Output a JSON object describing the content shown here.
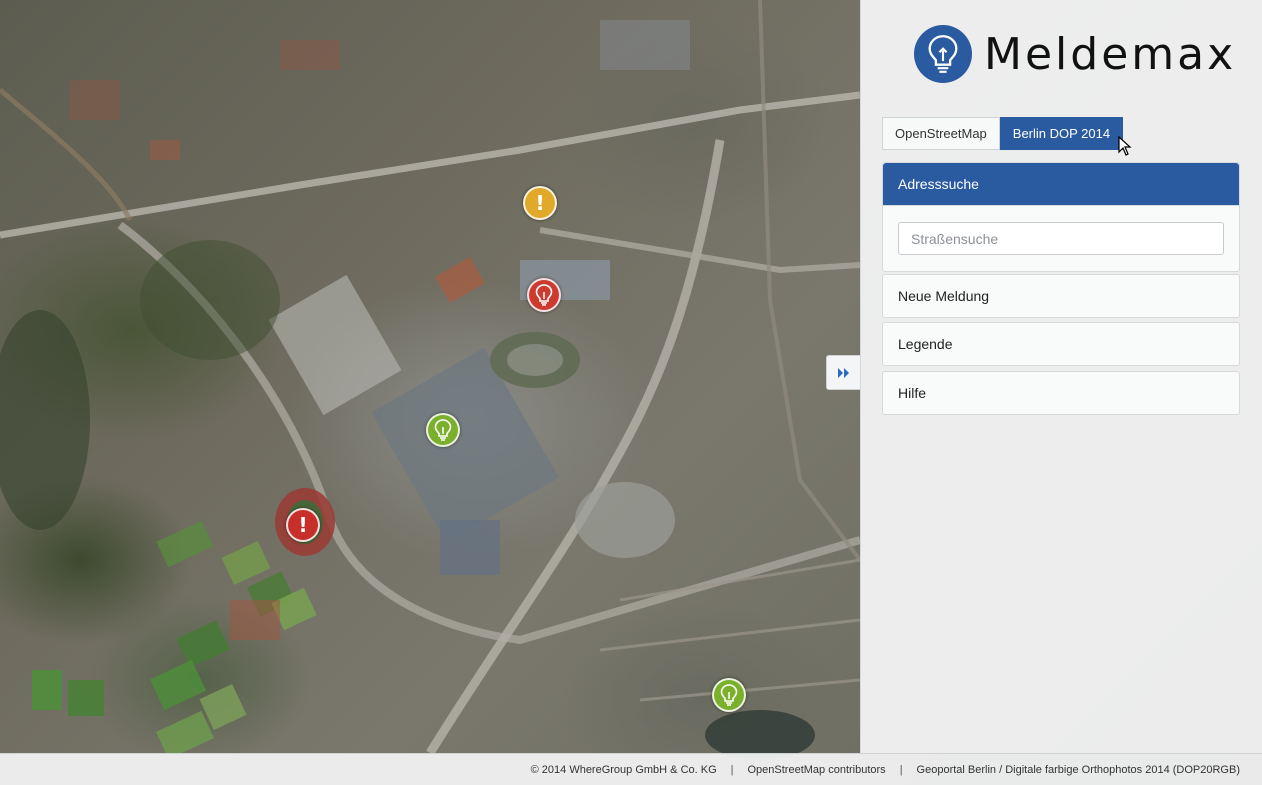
{
  "app": {
    "title": "Meldemax"
  },
  "layers": [
    {
      "label": "OpenStreetMap",
      "active": false
    },
    {
      "label": "Berlin DOP 2014",
      "active": true
    }
  ],
  "panels": {
    "address_search": {
      "title": "Adresssuche",
      "placeholder": "Straßensuche",
      "value": ""
    },
    "new_report": {
      "title": "Neue Meldung"
    },
    "legend": {
      "title": "Legende"
    },
    "help": {
      "title": "Hilfe"
    }
  },
  "collapse_button": {
    "icon": "double-chevron-right-icon",
    "glyph": "⏩"
  },
  "markers": [
    {
      "type": "warning",
      "color": "#e0a92a",
      "glyph": "!"
    },
    {
      "type": "report-red",
      "color": "#cc3b30",
      "glyph": "bulb"
    },
    {
      "type": "report-green",
      "color": "#7bb02c",
      "glyph": "bulb"
    },
    {
      "type": "warning-red",
      "color": "#c7302a",
      "glyph": "!"
    },
    {
      "type": "report-green",
      "color": "#7bb02c",
      "glyph": "bulb"
    }
  ],
  "colors": {
    "accent": "#2a5aa0",
    "warning": "#e0a92a",
    "danger": "#cc3b30",
    "ok": "#7bb02c"
  },
  "footer": {
    "credits": [
      "© 2014 WhereGroup GmbH & Co. KG",
      "OpenStreetMap contributors",
      "Geoportal Berlin / Digitale farbige Orthophotos 2014 (DOP20RGB)"
    ],
    "separator": "|"
  }
}
